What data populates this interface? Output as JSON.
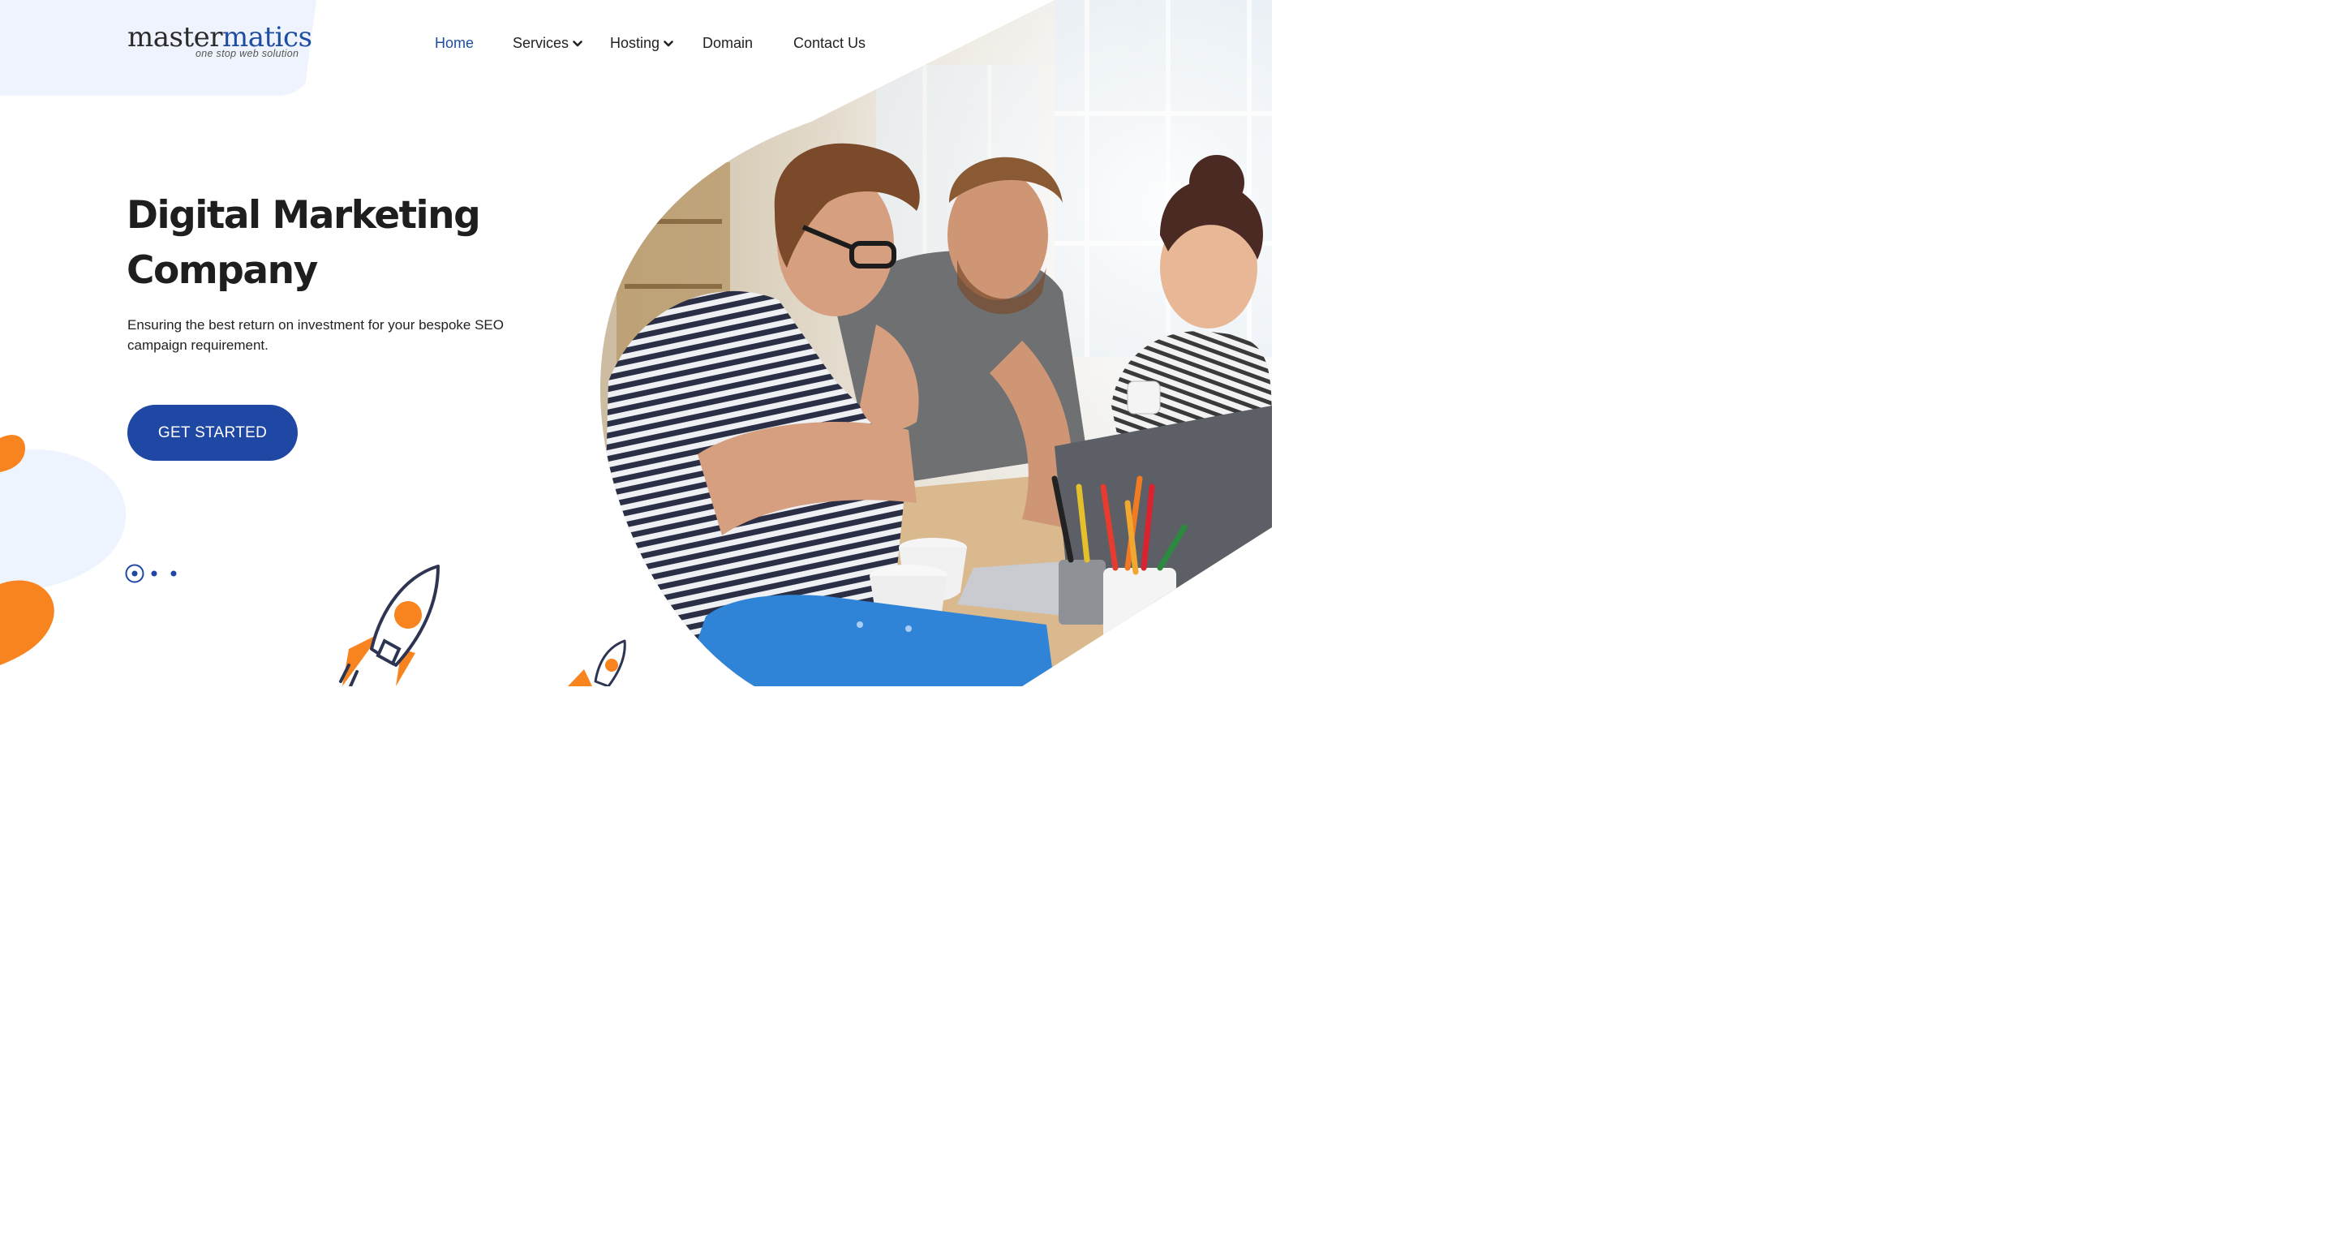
{
  "brand": {
    "name_part1": "master",
    "name_part2": "matics",
    "tagline": "one stop web solution"
  },
  "nav": {
    "home": "Home",
    "services": "Services",
    "hosting": "Hosting",
    "domain": "Domain",
    "contact": "Contact Us",
    "active": "Home"
  },
  "hero": {
    "title_line1": "Digital Marketing",
    "title_line2": "Company",
    "subtitle": "Ensuring the best return on investment for your bespoke SEO campaign requirement.",
    "cta_label": "GET STARTED"
  },
  "slider": {
    "total": 3,
    "current": 1
  },
  "colors": {
    "brand_blue": "#1f47a4",
    "nav_active": "#1f4ea0",
    "accent_orange": "#f7841f",
    "soft_blue": "#eef3fd"
  },
  "icons": [
    "chevron-down-icon",
    "rocket-icon"
  ]
}
